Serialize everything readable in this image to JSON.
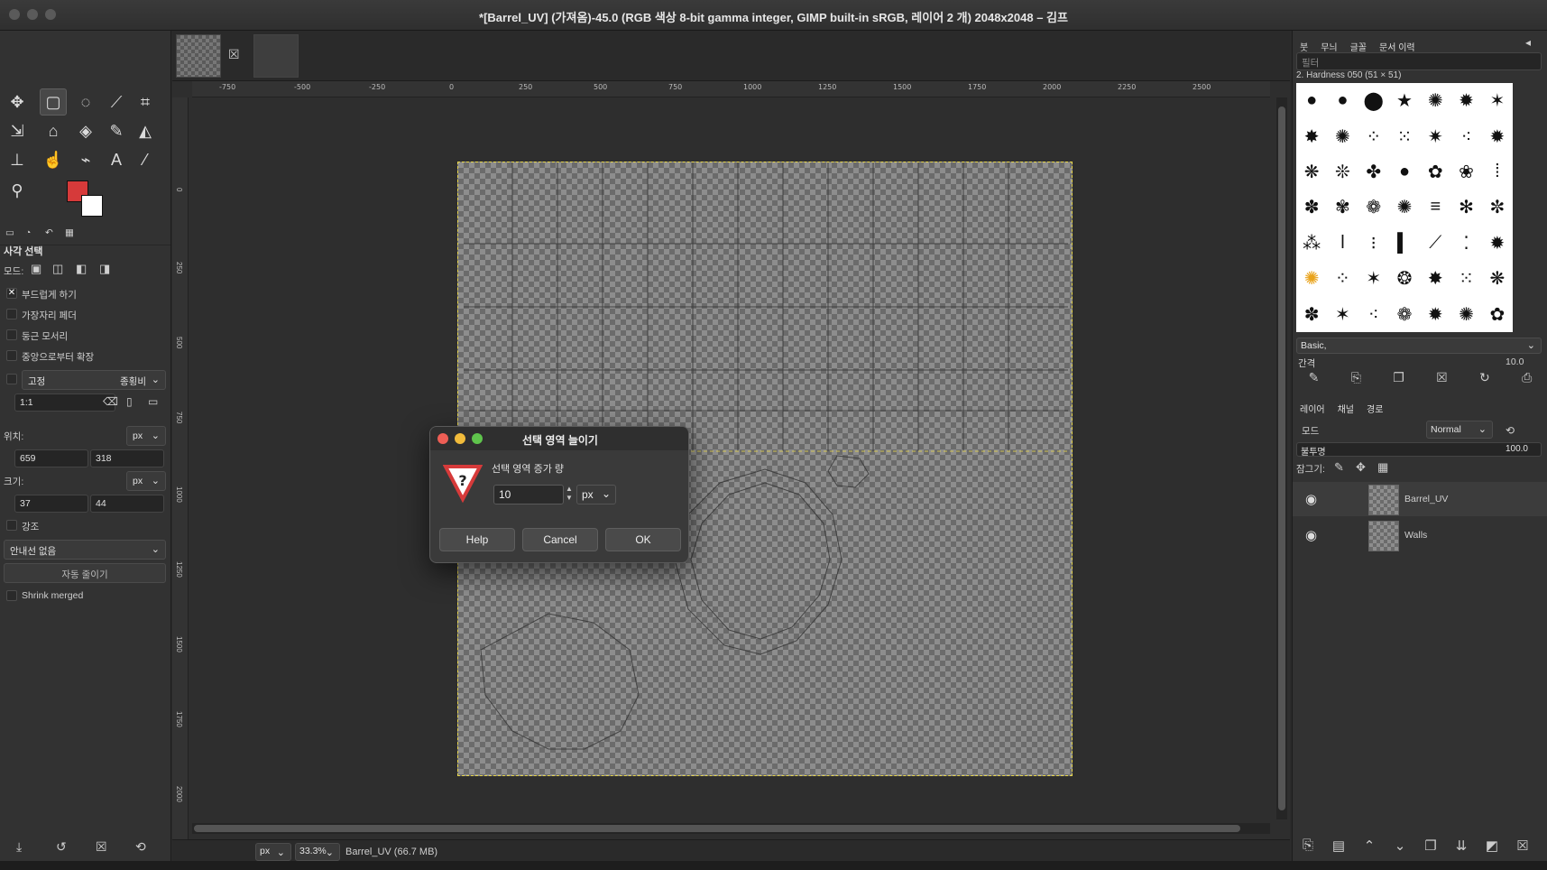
{
  "window": {
    "title": "*[Barrel_UV] (가져옴)-45.0 (RGB 색상 8-bit gamma integer, GIMP built-in sRGB, 레이어 2 개) 2048x2048 – 김프"
  },
  "toolbox": {
    "tool_options_title": "사각 선택",
    "mode_label": "모드:",
    "antialias_label": "부드럽게 하기",
    "feather_label": "가장자리 페더",
    "rounded_label": "둥근 모서리",
    "expand_center_label": "중앙으로부터 확장",
    "fixed_label": "고정",
    "fixed_value": "종횡비",
    "ratio_value": "1:1",
    "position_label": "위치:",
    "position_unit": "px",
    "position_x": "659",
    "position_y": "318",
    "size_label": "크기:",
    "size_unit": "px",
    "size_w": "37",
    "size_h": "44",
    "highlight_label": "강조",
    "guides_value": "안내선 없음",
    "auto_shrink_label": "자동 줄이기",
    "shrink_merged_label": "Shrink merged"
  },
  "rulers": {
    "h_ticks": [
      "-750",
      "-500",
      "-250",
      "0",
      "250",
      "500",
      "750",
      "1000",
      "1250",
      "1500",
      "1750",
      "2000",
      "2250",
      "2500"
    ],
    "v_ticks": [
      "0",
      "250",
      "500",
      "750",
      "1000",
      "1250",
      "1500",
      "1750",
      "2000"
    ]
  },
  "statusbar": {
    "unit": "px",
    "zoom": "33.3%",
    "info": "Barrel_UV (66.7 MB)"
  },
  "right_panel": {
    "tabs": [
      "붓",
      "무늬",
      "글꼴",
      "문서 이력"
    ],
    "filter_placeholder": "필터",
    "brush_name": "2. Hardness 050 (51 × 51)",
    "brush_set": "Basic,",
    "spacing_label": "간격",
    "spacing_value": "10.0",
    "layer_tabs": [
      "레이어",
      "채널",
      "경로"
    ],
    "mode_label": "모드",
    "mode_value": "Normal",
    "opacity_label": "불투명",
    "opacity_value": "100.0",
    "lock_label": "잠그기:",
    "layers": [
      {
        "name": "Barrel_UV",
        "selected": true
      },
      {
        "name": "Walls",
        "selected": false
      }
    ]
  },
  "dialog": {
    "title": "선택 영역 늘이기",
    "label": "선택 영역 증가 량",
    "value": "10",
    "unit": "px",
    "help": "Help",
    "cancel": "Cancel",
    "ok": "OK"
  },
  "colors": {
    "foreground": "#d63a3a",
    "background": "#ffffff",
    "selection": "#e8d64a"
  }
}
